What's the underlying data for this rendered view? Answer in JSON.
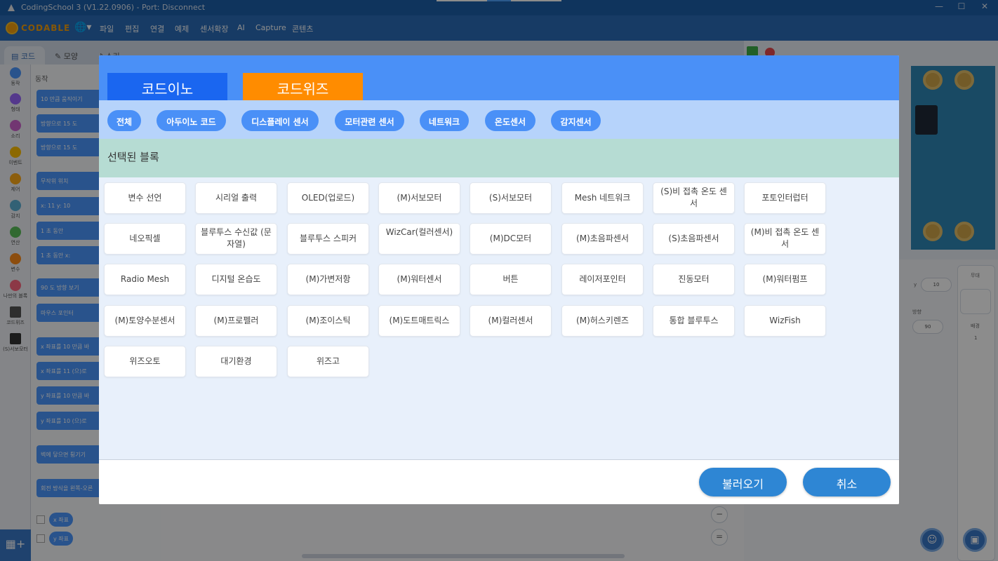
{
  "window": {
    "title": "CodingSchool 3 (V1.22.0906) - Port: Disconnect"
  },
  "menubar": {
    "logo_text": "CODABLE",
    "items": [
      "파일",
      "편집",
      "연결",
      "예제",
      "센서확장",
      "AI",
      "Capture",
      "콘텐츠"
    ]
  },
  "editor_tabs": [
    "코드",
    "모양",
    "소리"
  ],
  "categories": [
    {
      "label": "동작",
      "color": "#4c97ff"
    },
    {
      "label": "형태",
      "color": "#9966ff"
    },
    {
      "label": "소리",
      "color": "#cf63cf"
    },
    {
      "label": "이벤트",
      "color": "#ffbf00"
    },
    {
      "label": "제어",
      "color": "#ffab19"
    },
    {
      "label": "감지",
      "color": "#5cb1d6"
    },
    {
      "label": "연산",
      "color": "#59c059"
    },
    {
      "label": "변수",
      "color": "#ff8c1a"
    },
    {
      "label": "나만의 블록",
      "color": "#ff6680"
    },
    {
      "label": "코드위즈",
      "color": "#555555"
    },
    {
      "label": "(S)서보모터",
      "color": "#333333"
    }
  ],
  "palette": {
    "heading": "동작",
    "blocks": [
      "10 만큼 움직이기",
      "방향으로 15 도",
      "방향으로 15 도",
      "무작위 위치",
      "x: 11 y: 10",
      "1 초 동안",
      "1 초 동안 x:",
      "90 도 방향 보기",
      "마우스 포인터",
      "x 좌표를 10 만큼 바",
      "x 좌표를 11 (으)로",
      "y 좌표를 10 만큼 바",
      "y 좌표를 10 (으)로",
      "벽에 닿으면 튕기기",
      "회전 방식을 왼쪽-오른"
    ],
    "reporters": [
      "x 좌표",
      "y 좌표"
    ]
  },
  "sprite_info": {
    "y_label": "y",
    "y_value": "10",
    "direction_label": "방향",
    "direction_value": "90",
    "stage_label": "무대",
    "backdrop_label": "배경",
    "backdrop_count": "1"
  },
  "modal": {
    "top_tabs": [
      {
        "label": "코드이노",
        "style": "blue"
      },
      {
        "label": "코드위즈",
        "style": "orange"
      }
    ],
    "filters": [
      "전체",
      "아두이노 코드",
      "디스플레이 센서",
      "모터관련 센서",
      "네트워크",
      "온도센서",
      "감지센서"
    ],
    "selected_label": "선택된 블록",
    "cards": [
      [
        "변수 선언",
        "시리얼 출력",
        "OLED(업로드)",
        "(M)서보모터",
        "(S)서보모터",
        "Mesh 네트워크",
        "(S)비 접촉 온도 센서",
        "포토인터럽터"
      ],
      [
        "네오픽셀",
        "블루투스 수신값 (문자열)",
        "블루투스 스피커",
        "WizCar(컬러센서)",
        "(M)DC모터",
        "(M)초음파센서",
        "(S)초음파센서",
        "(M)비 접촉 온도 센서"
      ],
      [
        "Radio Mesh",
        "디지털 온습도",
        "(M)가변저항",
        "(M)워터센서",
        "버튼",
        "레이저포인터",
        "진동모터",
        "(M)워터펌프"
      ],
      [
        "(M)토양수분센서",
        "(M)프로펠러",
        "(M)조이스틱",
        "(M)도트매트릭스",
        "(M)컬러센서",
        "(M)허스키렌즈",
        "통합 블루투스",
        "WizFish"
      ],
      [
        "위즈오토",
        "대기환경",
        "위즈고"
      ]
    ],
    "load_button": "불러오기",
    "cancel_button": "취소"
  }
}
